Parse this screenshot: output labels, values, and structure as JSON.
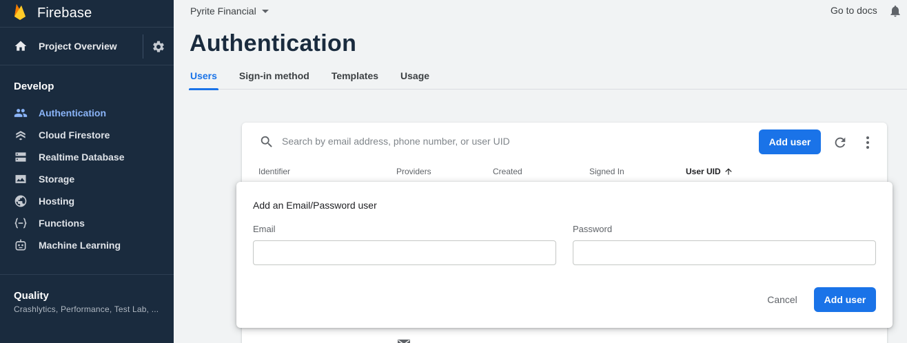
{
  "brand": {
    "name": "Firebase",
    "logo_icon": "firebase-flame-icon"
  },
  "sidebar": {
    "overview_label": "Project Overview",
    "sections": {
      "develop_title": "Develop",
      "quality_title": "Quality",
      "quality_subtitle": "Crashlytics, Performance, Test Lab, ..."
    },
    "items": [
      {
        "label": "Authentication",
        "icon": "users-icon",
        "active": true
      },
      {
        "label": "Cloud Firestore",
        "icon": "firestore-icon"
      },
      {
        "label": "Realtime Database",
        "icon": "database-icon"
      },
      {
        "label": "Storage",
        "icon": "storage-icon"
      },
      {
        "label": "Hosting",
        "icon": "globe-icon"
      },
      {
        "label": "Functions",
        "icon": "functions-icon"
      },
      {
        "label": "Machine Learning",
        "icon": "robot-icon"
      }
    ]
  },
  "header": {
    "project": "Pyrite Financial",
    "docs_link": "Go to docs",
    "title": "Authentication"
  },
  "tabs": [
    {
      "label": "Users",
      "active": true
    },
    {
      "label": "Sign-in method"
    },
    {
      "label": "Templates"
    },
    {
      "label": "Usage"
    }
  ],
  "users_card": {
    "search_placeholder": "Search by email address, phone number, or user UID",
    "add_user_label": "Add user",
    "columns": {
      "identifier": "Identifier",
      "providers": "Providers",
      "created": "Created",
      "signed_in": "Signed In",
      "user_uid": "User UID"
    }
  },
  "dialog": {
    "title": "Add an Email/Password user",
    "email_label": "Email",
    "email_value": "",
    "password_label": "Password",
    "password_value": "",
    "cancel_label": "Cancel",
    "add_label": "Add user"
  },
  "colors": {
    "sidebar_bg": "#1a2b3e",
    "accent": "#1a73e8",
    "active_nav": "#8ab4f8",
    "page_bg": "#f1f3f4"
  }
}
